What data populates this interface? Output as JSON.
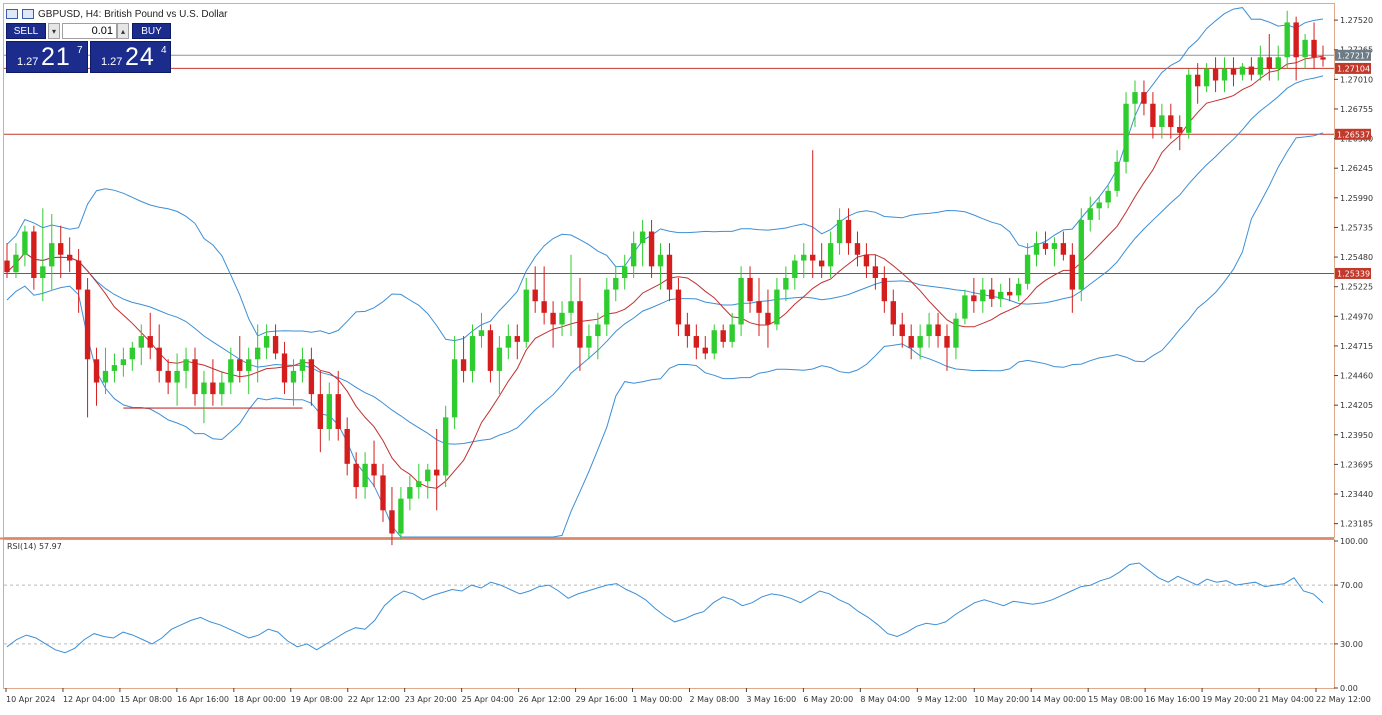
{
  "header": {
    "title": "GBPUSD, H4:  British Pound vs U.S. Dollar"
  },
  "trade_panel": {
    "sell_label": "SELL",
    "buy_label": "BUY",
    "lot_value": "0.01",
    "sell_prefix": "1.27",
    "sell_big": "21",
    "sell_sup": "7",
    "buy_prefix": "1.27",
    "buy_big": "24",
    "buy_sup": "4"
  },
  "colors": {
    "bull": "#2ecc2e",
    "bear": "#d41d1d",
    "bollinger": "#3d8fd6",
    "ma": "#c23030",
    "hline": "#c0392b",
    "rsi": "#3d8fd6",
    "price_tag": "#c0392b",
    "current_tag": "#6d7b86"
  },
  "chart_data": [
    {
      "type": "candlestick",
      "symbol": "GBPUSD",
      "timeframe": "H4",
      "ylim": [
        1.2307,
        1.2765
      ],
      "y_ticks": [
        "1.27520",
        "1.27265",
        "1.27010",
        "1.26755",
        "1.26500",
        "1.26245",
        "1.25990",
        "1.25735",
        "1.25480",
        "1.25225",
        "1.24970",
        "1.24715",
        "1.24460",
        "1.24205",
        "1.23950",
        "1.23695",
        "1.23440",
        "1.23185"
      ],
      "x_labels": [
        "10 Apr 2024",
        "12 Apr 04:00",
        "15 Apr 08:00",
        "16 Apr 16:00",
        "18 Apr 00:00",
        "19 Apr 08:00",
        "22 Apr 12:00",
        "23 Apr 20:00",
        "25 Apr 04:00",
        "26 Apr 12:00",
        "29 Apr 16:00",
        "1 May 00:00",
        "2 May 08:00",
        "3 May 16:00",
        "6 May 20:00",
        "8 May 04:00",
        "9 May 12:00",
        "10 May 20:00",
        "14 May 00:00",
        "15 May 08:00",
        "16 May 16:00",
        "19 May 20:00",
        "21 May 04:00",
        "22 May 12:00"
      ],
      "horizontal_lines": [
        {
          "price": 1.27217,
          "label": "1.27217",
          "kind": "current"
        },
        {
          "price": 1.27104,
          "label": "1.27104",
          "kind": "level"
        },
        {
          "price": 1.26537,
          "label": "1.26537",
          "kind": "level"
        },
        {
          "price": 1.25339,
          "label": "1.25339",
          "kind": "level"
        }
      ],
      "trend_segment": {
        "from_index": 13,
        "to_index": 33,
        "price": 1.2418
      },
      "candles": [
        [
          1.2545,
          1.256,
          1.253,
          1.2535
        ],
        [
          1.2535,
          1.256,
          1.253,
          1.255
        ],
        [
          1.255,
          1.2575,
          1.254,
          1.257
        ],
        [
          1.257,
          1.2575,
          1.252,
          1.253
        ],
        [
          1.253,
          1.259,
          1.251,
          1.254
        ],
        [
          1.254,
          1.2585,
          1.252,
          1.256
        ],
        [
          1.256,
          1.2575,
          1.253,
          1.255
        ],
        [
          1.255,
          1.2565,
          1.2535,
          1.2545
        ],
        [
          1.2545,
          1.2555,
          1.25,
          1.252
        ],
        [
          1.252,
          1.253,
          1.241,
          1.246
        ],
        [
          1.246,
          1.247,
          1.242,
          1.244
        ],
        [
          1.244,
          1.247,
          1.243,
          1.245
        ],
        [
          1.245,
          1.2465,
          1.244,
          1.2455
        ],
        [
          1.2455,
          1.247,
          1.2445,
          1.246
        ],
        [
          1.246,
          1.2475,
          1.245,
          1.247
        ],
        [
          1.247,
          1.249,
          1.2455,
          1.248
        ],
        [
          1.248,
          1.25,
          1.246,
          1.247
        ],
        [
          1.247,
          1.249,
          1.244,
          1.245
        ],
        [
          1.245,
          1.246,
          1.243,
          1.244
        ],
        [
          1.244,
          1.2465,
          1.242,
          1.245
        ],
        [
          1.245,
          1.247,
          1.2435,
          1.246
        ],
        [
          1.246,
          1.247,
          1.242,
          1.243
        ],
        [
          1.243,
          1.245,
          1.2405,
          1.244
        ],
        [
          1.244,
          1.246,
          1.242,
          1.243
        ],
        [
          1.243,
          1.245,
          1.242,
          1.244
        ],
        [
          1.244,
          1.247,
          1.243,
          1.246
        ],
        [
          1.246,
          1.248,
          1.244,
          1.245
        ],
        [
          1.245,
          1.247,
          1.243,
          1.246
        ],
        [
          1.246,
          1.249,
          1.244,
          1.247
        ],
        [
          1.247,
          1.249,
          1.246,
          1.248
        ],
        [
          1.248,
          1.249,
          1.246,
          1.2465
        ],
        [
          1.2465,
          1.2475,
          1.243,
          1.244
        ],
        [
          1.244,
          1.246,
          1.242,
          1.245
        ],
        [
          1.245,
          1.247,
          1.244,
          1.246
        ],
        [
          1.246,
          1.247,
          1.242,
          1.243
        ],
        [
          1.243,
          1.245,
          1.238,
          1.24
        ],
        [
          1.24,
          1.244,
          1.239,
          1.243
        ],
        [
          1.243,
          1.245,
          1.239,
          1.24
        ],
        [
          1.24,
          1.241,
          1.236,
          1.237
        ],
        [
          1.237,
          1.238,
          1.234,
          1.235
        ],
        [
          1.235,
          1.238,
          1.234,
          1.237
        ],
        [
          1.237,
          1.239,
          1.235,
          1.236
        ],
        [
          1.236,
          1.237,
          1.232,
          1.233
        ],
        [
          1.233,
          1.235,
          1.23,
          1.231
        ],
        [
          1.231,
          1.235,
          1.2305,
          1.234
        ],
        [
          1.234,
          1.236,
          1.233,
          1.235
        ],
        [
          1.235,
          1.237,
          1.234,
          1.2355
        ],
        [
          1.2355,
          1.237,
          1.234,
          1.2365
        ],
        [
          1.2365,
          1.24,
          1.233,
          1.236
        ],
        [
          1.236,
          1.242,
          1.235,
          1.241
        ],
        [
          1.241,
          1.248,
          1.24,
          1.246
        ],
        [
          1.246,
          1.248,
          1.244,
          1.245
        ],
        [
          1.245,
          1.249,
          1.244,
          1.248
        ],
        [
          1.248,
          1.25,
          1.247,
          1.2485
        ],
        [
          1.2485,
          1.249,
          1.244,
          1.245
        ],
        [
          1.245,
          1.248,
          1.243,
          1.247
        ],
        [
          1.247,
          1.249,
          1.246,
          1.248
        ],
        [
          1.248,
          1.249,
          1.246,
          1.2475
        ],
        [
          1.2475,
          1.253,
          1.247,
          1.252
        ],
        [
          1.252,
          1.254,
          1.25,
          1.251
        ],
        [
          1.251,
          1.254,
          1.249,
          1.25
        ],
        [
          1.25,
          1.251,
          1.247,
          1.249
        ],
        [
          1.249,
          1.251,
          1.248,
          1.25
        ],
        [
          1.25,
          1.255,
          1.248,
          1.251
        ],
        [
          1.251,
          1.253,
          1.245,
          1.247
        ],
        [
          1.247,
          1.249,
          1.246,
          1.248
        ],
        [
          1.248,
          1.25,
          1.246,
          1.249
        ],
        [
          1.249,
          1.253,
          1.248,
          1.252
        ],
        [
          1.252,
          1.254,
          1.251,
          1.253
        ],
        [
          1.253,
          1.255,
          1.252,
          1.254
        ],
        [
          1.254,
          1.257,
          1.253,
          1.256
        ],
        [
          1.256,
          1.258,
          1.254,
          1.257
        ],
        [
          1.257,
          1.258,
          1.253,
          1.254
        ],
        [
          1.254,
          1.256,
          1.252,
          1.255
        ],
        [
          1.255,
          1.256,
          1.251,
          1.252
        ],
        [
          1.252,
          1.253,
          1.248,
          1.249
        ],
        [
          1.249,
          1.25,
          1.247,
          1.248
        ],
        [
          1.248,
          1.249,
          1.246,
          1.247
        ],
        [
          1.247,
          1.248,
          1.246,
          1.2465
        ],
        [
          1.2465,
          1.249,
          1.246,
          1.2485
        ],
        [
          1.2485,
          1.249,
          1.247,
          1.2475
        ],
        [
          1.2475,
          1.25,
          1.247,
          1.249
        ],
        [
          1.249,
          1.254,
          1.248,
          1.253
        ],
        [
          1.253,
          1.254,
          1.25,
          1.251
        ],
        [
          1.251,
          1.253,
          1.248,
          1.25
        ],
        [
          1.25,
          1.252,
          1.247,
          1.249
        ],
        [
          1.249,
          1.253,
          1.2485,
          1.252
        ],
        [
          1.252,
          1.254,
          1.251,
          1.253
        ],
        [
          1.253,
          1.255,
          1.252,
          1.2545
        ],
        [
          1.2545,
          1.256,
          1.253,
          1.255
        ],
        [
          1.255,
          1.264,
          1.253,
          1.2545
        ],
        [
          1.2545,
          1.256,
          1.253,
          1.254
        ],
        [
          1.254,
          1.257,
          1.253,
          1.256
        ],
        [
          1.256,
          1.259,
          1.255,
          1.258
        ],
        [
          1.258,
          1.259,
          1.255,
          1.256
        ],
        [
          1.256,
          1.257,
          1.254,
          1.255
        ],
        [
          1.255,
          1.256,
          1.253,
          1.254
        ],
        [
          1.254,
          1.255,
          1.252,
          1.253
        ],
        [
          1.253,
          1.254,
          1.25,
          1.251
        ],
        [
          1.251,
          1.252,
          1.248,
          1.249
        ],
        [
          1.249,
          1.25,
          1.247,
          1.248
        ],
        [
          1.248,
          1.249,
          1.246,
          1.247
        ],
        [
          1.247,
          1.249,
          1.246,
          1.248
        ],
        [
          1.248,
          1.25,
          1.247,
          1.249
        ],
        [
          1.249,
          1.25,
          1.247,
          1.248
        ],
        [
          1.248,
          1.249,
          1.245,
          1.247
        ],
        [
          1.247,
          1.25,
          1.246,
          1.2495
        ],
        [
          1.2495,
          1.252,
          1.249,
          1.2515
        ],
        [
          1.2515,
          1.253,
          1.25,
          1.251
        ],
        [
          1.251,
          1.253,
          1.25,
          1.252
        ],
        [
          1.252,
          1.253,
          1.2505,
          1.2512
        ],
        [
          1.2512,
          1.2525,
          1.2505,
          1.2518
        ],
        [
          1.2518,
          1.253,
          1.251,
          1.2515
        ],
        [
          1.2515,
          1.253,
          1.251,
          1.2525
        ],
        [
          1.2525,
          1.256,
          1.252,
          1.255
        ],
        [
          1.255,
          1.257,
          1.254,
          1.256
        ],
        [
          1.256,
          1.257,
          1.255,
          1.2555
        ],
        [
          1.2555,
          1.2565,
          1.254,
          1.256
        ],
        [
          1.256,
          1.257,
          1.2545,
          1.255
        ],
        [
          1.255,
          1.256,
          1.25,
          1.252
        ],
        [
          1.252,
          1.259,
          1.251,
          1.258
        ],
        [
          1.258,
          1.26,
          1.257,
          1.259
        ],
        [
          1.259,
          1.26,
          1.258,
          1.2595
        ],
        [
          1.2595,
          1.261,
          1.259,
          1.2605
        ],
        [
          1.2605,
          1.264,
          1.26,
          1.263
        ],
        [
          1.263,
          1.269,
          1.262,
          1.268
        ],
        [
          1.268,
          1.27,
          1.266,
          1.269
        ],
        [
          1.269,
          1.27,
          1.267,
          1.268
        ],
        [
          1.268,
          1.269,
          1.265,
          1.266
        ],
        [
          1.266,
          1.268,
          1.265,
          1.267
        ],
        [
          1.267,
          1.268,
          1.265,
          1.266
        ],
        [
          1.266,
          1.267,
          1.264,
          1.2655
        ],
        [
          1.2655,
          1.271,
          1.265,
          1.2705
        ],
        [
          1.2705,
          1.2715,
          1.268,
          1.2695
        ],
        [
          1.2695,
          1.2715,
          1.269,
          1.271
        ],
        [
          1.271,
          1.272,
          1.269,
          1.27
        ],
        [
          1.27,
          1.272,
          1.269,
          1.271
        ],
        [
          1.271,
          1.272,
          1.2695,
          1.2705
        ],
        [
          1.2705,
          1.2715,
          1.27,
          1.2712
        ],
        [
          1.2712,
          1.272,
          1.27,
          1.2705
        ],
        [
          1.2705,
          1.273,
          1.27,
          1.272
        ],
        [
          1.272,
          1.274,
          1.27,
          1.271
        ],
        [
          1.271,
          1.273,
          1.27,
          1.272
        ],
        [
          1.272,
          1.276,
          1.271,
          1.275
        ],
        [
          1.275,
          1.2755,
          1.27,
          1.272
        ],
        [
          1.272,
          1.274,
          1.271,
          1.2735
        ],
        [
          1.2735,
          1.275,
          1.271,
          1.272
        ],
        [
          1.272,
          1.273,
          1.2712,
          1.2718
        ]
      ]
    },
    {
      "type": "line",
      "indicator": "RSI",
      "label": "RSI(14) 57.97",
      "ylim": [
        0,
        100
      ],
      "y_ticks": [
        "100.00",
        "70.00",
        "30.00",
        "0.00"
      ],
      "levels": [
        70,
        30
      ],
      "values": [
        28,
        33,
        36,
        34,
        30,
        26,
        24,
        27,
        33,
        37,
        35,
        34,
        38,
        36,
        33,
        30,
        34,
        40,
        43,
        46,
        48,
        45,
        43,
        40,
        37,
        34,
        36,
        40,
        38,
        32,
        28,
        30,
        26,
        30,
        34,
        38,
        41,
        40,
        46,
        56,
        62,
        66,
        64,
        60,
        63,
        65,
        67,
        66,
        70,
        68,
        72,
        70,
        67,
        64,
        66,
        69,
        70,
        66,
        61,
        64,
        66,
        68,
        70,
        71,
        67,
        64,
        60,
        54,
        49,
        45,
        47,
        50,
        52,
        58,
        62,
        60,
        56,
        58,
        62,
        64,
        63,
        61,
        58,
        62,
        66,
        64,
        60,
        57,
        52,
        48,
        43,
        37,
        35,
        38,
        42,
        44,
        43,
        45,
        50,
        54,
        58,
        60,
        58,
        56,
        59,
        58,
        57,
        58,
        60,
        63,
        66,
        69,
        70,
        73,
        75,
        79,
        84,
        85,
        80,
        75,
        72,
        76,
        73,
        70,
        74,
        72,
        73,
        70,
        71,
        72,
        69,
        70,
        71,
        75,
        66,
        64,
        57.97
      ]
    }
  ]
}
